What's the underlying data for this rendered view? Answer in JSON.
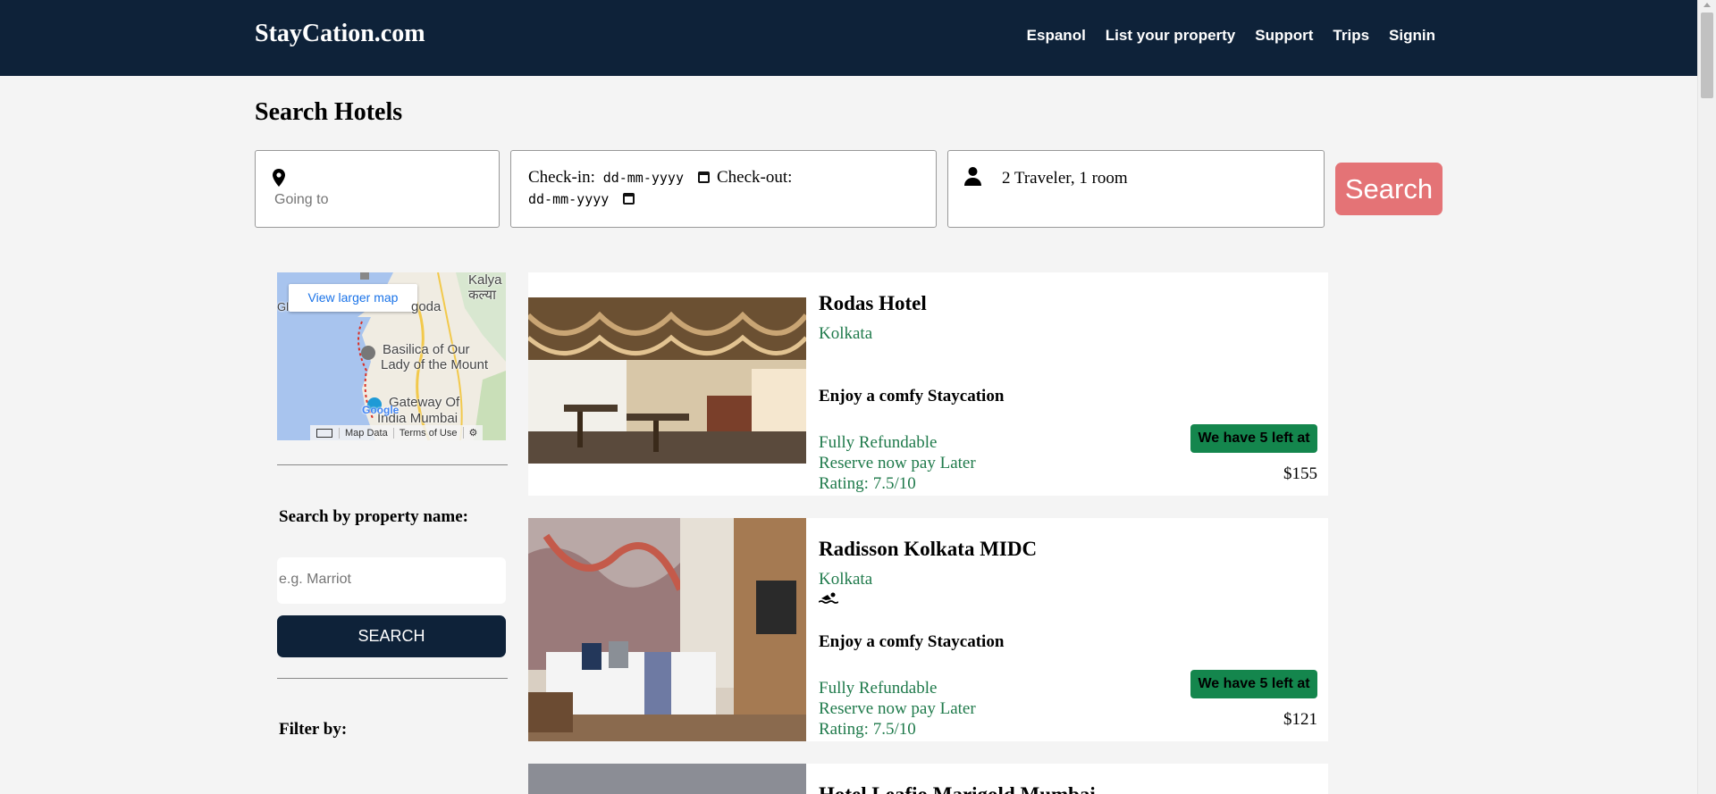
{
  "header": {
    "brand": "StayCation.com",
    "nav": [
      "Espanol",
      "List your property",
      "Support",
      "Trips",
      "Signin"
    ]
  },
  "search": {
    "title": "Search Hotels",
    "location_placeholder": "Going to",
    "checkin_label": "Check-in:",
    "checkin_value": "dd-mm-yyyy",
    "checkout_label": "Check-out:",
    "checkout_value": "dd-mm-yyyy",
    "travelers": "2 Traveler, 1 room",
    "button": "Search"
  },
  "map": {
    "view_larger": "View larger map",
    "labels": [
      "Kalya",
      "कल्या",
      "Gl",
      "goda",
      "Basilica of Our",
      "Lady of the Mount",
      "Gateway Of",
      "India Mumbai",
      "Google"
    ],
    "footer": [
      "Map Data",
      "Terms of Use"
    ]
  },
  "sidebar": {
    "property_heading": "Search by property name:",
    "property_placeholder": "e.g. Marriot",
    "search_button": "SEARCH",
    "filter_heading": "Filter by:"
  },
  "hotels": [
    {
      "name": "Rodas Hotel",
      "city": "Kolkata",
      "tagline": "Enjoy a comfy Staycation",
      "refund": "Fully Refundable",
      "reserve": "Reserve now pay Later",
      "rating": "Rating: 7.5/10",
      "badge": "We have 5 left at",
      "price": "$155",
      "amenity_icon": "swimming-icon-hidden"
    },
    {
      "name": "Radisson Kolkata MIDC",
      "city": "Kolkata",
      "tagline": "Enjoy a comfy Staycation",
      "refund": "Fully Refundable",
      "reserve": "Reserve now pay Later",
      "rating": "Rating: 7.5/10",
      "badge": "We have 5 left at",
      "price": "$121",
      "amenity_icon": "swimming-icon"
    },
    {
      "name": "Hotel Leafio Marigold Mumbai"
    }
  ],
  "colors": {
    "navbar": "#0e2239",
    "search_button": "#e47376",
    "green_text": "#1f7a4b",
    "badge": "#14864d"
  }
}
